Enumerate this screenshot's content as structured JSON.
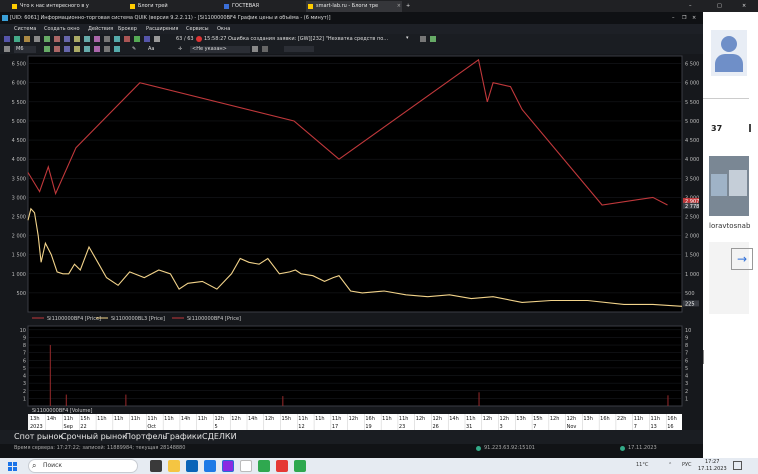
{
  "browser": {
    "tabs": [
      {
        "label": "Что к нас интересного в у"
      },
      {
        "label": "Блоги трей"
      },
      {
        "label": "ГОСТЕВАЯ"
      },
      {
        "label": "smart-lab.ru - Блоги тре"
      }
    ]
  },
  "quik": {
    "title": "[UID: 6061] Информационно-торговая система QUIK (версия 9.2.2.11) - [Si1100000BF4 График цены и объёма - (6 минут)]",
    "menu": [
      "Система",
      "Создать окно",
      "Действия",
      "Брокер",
      "Расширения",
      "Сервисы",
      "Окна"
    ],
    "toolbar": {
      "counter": "63 / 63",
      "time": "15:58:27",
      "message": "Ошибка создания заявки: [GW][232] \"Нехватка средств по...",
      "timeframe": "М6",
      "pair_select": "<Не указан>",
      "draw_label": "Aa"
    },
    "legend_price": [
      "Si1100000BF4 [Price]",
      "Si1100000BL3 [Price]",
      "Si1100000BF4 [Price]"
    ],
    "legend_volume": "Si1100000BF4 [Volume]",
    "status_tabs": [
      "Спот рынок",
      "Срочный рынок",
      "Портфель",
      "Графики",
      "СДЕЛКИ"
    ],
    "server_time": "Время сервера: 17:27:22; записей: 11889984; текущая 28148880",
    "ip": "91.223.63.92:15101",
    "date": "17.11.2023"
  },
  "chart_data": {
    "type": "line",
    "price_axis": {
      "ticks": [
        "6 500",
        "6 000",
        "5 500",
        "5 000",
        "4 500",
        "4 000",
        "3 500",
        "3 000",
        "2 500",
        "2 000",
        "1 500",
        "1 000",
        "500"
      ],
      "ylim": [
        0,
        6700
      ]
    },
    "right_labels": [
      "2 907",
      "2 778",
      "225"
    ],
    "volume_axis": {
      "ticks": [
        "10",
        "9",
        "8",
        "7",
        "6",
        "5",
        "4",
        "3",
        "2",
        "1"
      ],
      "ylim": [
        0,
        10.5
      ]
    },
    "x_labels_top": [
      "13h",
      "14h",
      "11h",
      "15h",
      "11h",
      "11h",
      "11h",
      "11h",
      "11h",
      "14h",
      "11h",
      "12h",
      "12h",
      "14h",
      "12h",
      "15h",
      "11h",
      "11h",
      "11h",
      "12h",
      "16h",
      "11h",
      "11h",
      "12h",
      "12h",
      "14h",
      "11h",
      "12h",
      "12h",
      "13h",
      "15h",
      "12h",
      "12h",
      "13h",
      "16h",
      "22h",
      "11h",
      "11h",
      "16h"
    ],
    "x_labels_bottom": [
      "2023",
      "",
      "Sep",
      "22",
      "",
      "",
      "",
      "Oct",
      "",
      "",
      "",
      "5",
      "",
      "",
      "",
      "",
      "12",
      "",
      "17",
      "",
      "19",
      "",
      "23",
      "",
      "26",
      "",
      "31",
      "",
      "3",
      "",
      "7",
      "",
      "Nov",
      "",
      "",
      "",
      "7",
      "13",
      "16"
    ],
    "series": [
      {
        "name": "Si1100000BF4 [Price]",
        "color": "#c0383b",
        "x": [
          0.0,
          0.8,
          1.4,
          1.9,
          3.3,
          7.7,
          18.3,
          21.4,
          31.0,
          31.6,
          32.0,
          33.2,
          34.0,
          39.5,
          43.0,
          44.0
        ],
        "y": [
          3650,
          3150,
          3800,
          3100,
          4300,
          6000,
          5000,
          4000,
          6600,
          5500,
          6000,
          5900,
          5300,
          2800,
          3000,
          2800
        ]
      },
      {
        "name": "Si1100000BL3 [Price]",
        "color": "#f2d38a",
        "x": [
          0.0,
          0.2,
          0.45,
          0.7,
          0.9,
          1.2,
          1.6,
          2.0,
          2.4,
          2.8,
          3.2,
          3.6,
          4.2,
          4.8,
          5.4,
          6.2,
          7.0,
          8.0,
          9.0,
          9.8,
          10.4,
          11.0,
          12.0,
          13.0,
          14.0,
          14.6,
          15.2,
          15.9,
          16.5,
          17.3,
          18.0,
          18.4,
          18.8,
          19.6,
          20.4,
          21.0,
          21.4,
          22.2,
          23.0,
          24.5,
          26.0,
          27.5,
          29.0,
          30.5,
          32.0,
          34.0,
          36.0,
          38.5,
          41.0,
          43.0,
          45.0
        ],
        "y": [
          2400,
          2700,
          2600,
          2000,
          1300,
          1800,
          1500,
          1050,
          1000,
          1000,
          1250,
          1100,
          1700,
          1300,
          900,
          700,
          1050,
          900,
          1100,
          1000,
          600,
          750,
          800,
          600,
          1000,
          1400,
          1300,
          1250,
          1400,
          1000,
          1050,
          1100,
          1000,
          950,
          800,
          900,
          950,
          550,
          500,
          550,
          450,
          400,
          450,
          350,
          400,
          250,
          300,
          300,
          200,
          200,
          150
        ]
      }
    ],
    "volume": {
      "x": [
        1.5,
        2.6,
        6.7,
        17.5,
        31.0,
        44.0
      ],
      "y": [
        8,
        1.5,
        1.5,
        1.3,
        1.8,
        1.4
      ]
    }
  },
  "sidepage": {
    "number": "37",
    "brand": "loravtosnab"
  },
  "taskbar": {
    "search_placeholder": "Поиск",
    "weather": "11°C",
    "lang": "РУС",
    "time": "17:27",
    "date": "17.11.2023"
  }
}
